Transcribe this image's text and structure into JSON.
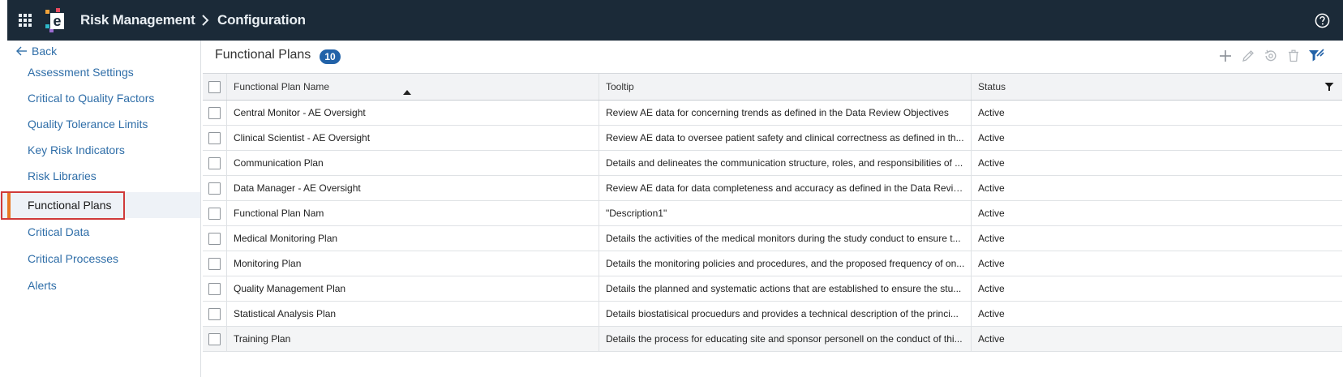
{
  "header": {
    "app_title": "Risk Management",
    "breadcrumb_page": "Configuration",
    "icons": [
      "apps-grid-icon",
      "app-logo",
      "chevron-right-icon",
      "help-icon"
    ]
  },
  "sidebar": {
    "back_label": "Back",
    "items": [
      {
        "label": "Assessment Settings"
      },
      {
        "label": "Critical to Quality Factors"
      },
      {
        "label": "Quality Tolerance Limits"
      },
      {
        "label": "Key Risk Indicators"
      },
      {
        "label": "Risk Libraries"
      },
      {
        "label": "Functional Plans",
        "active": true
      },
      {
        "label": "Critical Data"
      },
      {
        "label": "Critical Processes"
      },
      {
        "label": "Alerts"
      }
    ]
  },
  "main": {
    "title": "Functional Plans",
    "count": "10",
    "toolbar_icons": [
      "add-icon",
      "edit-icon",
      "restore-icon",
      "delete-icon",
      "filter-icon"
    ]
  },
  "table": {
    "columns": [
      "Functional Plan Name",
      "Tooltip",
      "Status"
    ],
    "sort": {
      "column": "Functional Plan Name",
      "direction": "ascending"
    },
    "rows": [
      {
        "name": "Central Monitor - AE Oversight",
        "tooltip": "Review AE data for concerning trends as defined in the Data Review Objectives",
        "status": "Active"
      },
      {
        "name": "Clinical Scientist - AE Oversight",
        "tooltip": "Review AE data to oversee patient safety and clinical correctness as defined in th...",
        "status": "Active"
      },
      {
        "name": "Communication Plan",
        "tooltip": "Details and delineates the communication structure, roles, and responsibilities of ...",
        "status": "Active"
      },
      {
        "name": "Data Manager - AE Oversight",
        "tooltip": "Review AE data for data completeness and accuracy as defined in the Data Revie...",
        "status": "Active"
      },
      {
        "name": "Functional Plan Nam",
        "tooltip": "\"Description1\"",
        "status": "Active"
      },
      {
        "name": "Medical Monitoring Plan",
        "tooltip": "Details the activities of the medical monitors during the study conduct to ensure t...",
        "status": "Active"
      },
      {
        "name": "Monitoring Plan",
        "tooltip": "Details the monitoring policies and procedures, and the proposed frequency of on...",
        "status": "Active"
      },
      {
        "name": "Quality Management Plan",
        "tooltip": "Details the planned and systematic actions that are established to ensure the stu...",
        "status": "Active"
      },
      {
        "name": "Statistical Analysis Plan",
        "tooltip": "Details biostatisical procuedurs and provides a technical description of the princi...",
        "status": "Active"
      },
      {
        "name": "Training Plan",
        "tooltip": "Details the process for educating site and sponsor personell on the conduct of thi...",
        "status": "Active"
      }
    ]
  },
  "colors": {
    "header_bg": "#1b2a38",
    "link": "#2f6ea8",
    "badge": "#2262a8",
    "active_marker": "#e87722",
    "highlight_outline": "#d03a3a"
  }
}
